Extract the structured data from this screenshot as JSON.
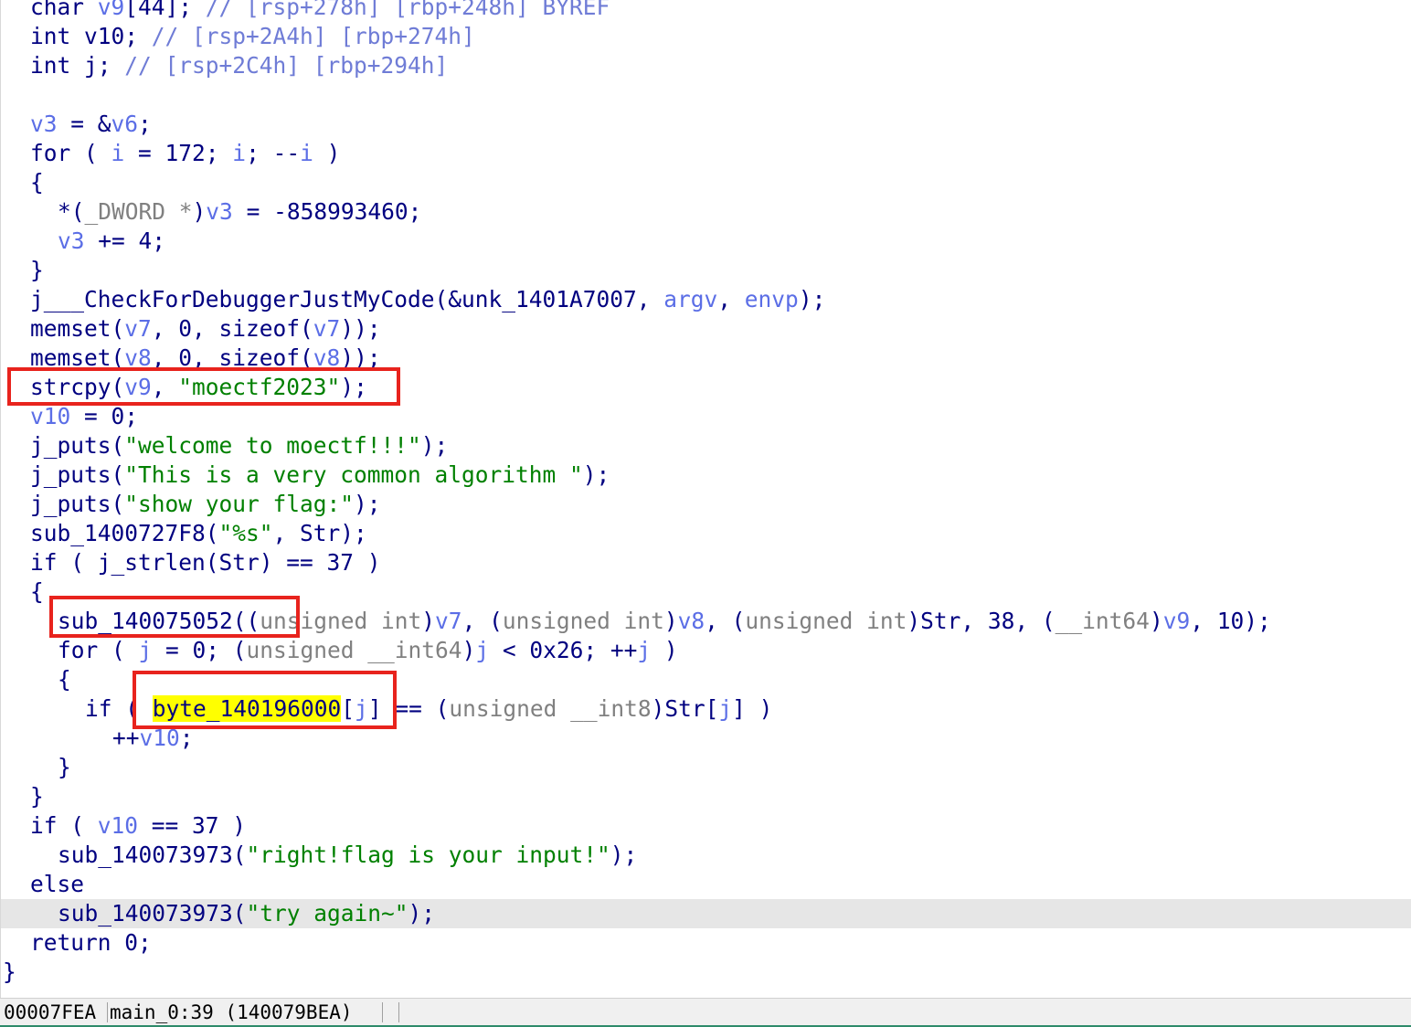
{
  "editor": {
    "lines": [
      {
        "indent": 2,
        "tokens": [
          {
            "t": "char ",
            "c": "k"
          },
          {
            "t": "v9",
            "c": "v"
          },
          {
            "t": "[44]; ",
            "c": "k"
          },
          {
            "t": "// [rsp+278h] [rbp+248h] BYREF",
            "c": "c"
          }
        ]
      },
      {
        "indent": 2,
        "tokens": [
          {
            "t": "int ",
            "c": "k"
          },
          {
            "t": "v10",
            "c": "k"
          },
          {
            "t": "; ",
            "c": "k"
          },
          {
            "t": "// [rsp+2A4h] [rbp+274h]",
            "c": "c"
          }
        ]
      },
      {
        "indent": 2,
        "tokens": [
          {
            "t": "int ",
            "c": "k"
          },
          {
            "t": "j",
            "c": "k"
          },
          {
            "t": "; ",
            "c": "k"
          },
          {
            "t": "// [rsp+2C4h] [rbp+294h]",
            "c": "c"
          }
        ]
      },
      {
        "indent": 0,
        "tokens": []
      },
      {
        "indent": 2,
        "tokens": [
          {
            "t": "v3",
            "c": "v"
          },
          {
            "t": " = &",
            "c": "k"
          },
          {
            "t": "v6",
            "c": "v"
          },
          {
            "t": ";",
            "c": "k"
          }
        ]
      },
      {
        "indent": 2,
        "tokens": [
          {
            "t": "for ( ",
            "c": "k"
          },
          {
            "t": "i",
            "c": "v"
          },
          {
            "t": " = 172; ",
            "c": "k"
          },
          {
            "t": "i",
            "c": "v"
          },
          {
            "t": "; --",
            "c": "k"
          },
          {
            "t": "i",
            "c": "v"
          },
          {
            "t": " )",
            "c": "k"
          }
        ]
      },
      {
        "indent": 2,
        "tokens": [
          {
            "t": "{",
            "c": "k"
          }
        ]
      },
      {
        "indent": 4,
        "tokens": [
          {
            "t": "*(",
            "c": "k"
          },
          {
            "t": "_DWORD *",
            "c": "t"
          },
          {
            "t": ")",
            "c": "k"
          },
          {
            "t": "v3",
            "c": "v"
          },
          {
            "t": " = -858993460;",
            "c": "k"
          }
        ]
      },
      {
        "indent": 4,
        "tokens": [
          {
            "t": "v3",
            "c": "v"
          },
          {
            "t": " += 4;",
            "c": "k"
          }
        ]
      },
      {
        "indent": 2,
        "tokens": [
          {
            "t": "}",
            "c": "k"
          }
        ]
      },
      {
        "indent": 2,
        "tokens": [
          {
            "t": "j___CheckForDebuggerJustMyCode(&unk_1401A7007, ",
            "c": "k"
          },
          {
            "t": "argv",
            "c": "v"
          },
          {
            "t": ", ",
            "c": "k"
          },
          {
            "t": "envp",
            "c": "v"
          },
          {
            "t": ");",
            "c": "k"
          }
        ]
      },
      {
        "indent": 2,
        "tokens": [
          {
            "t": "memset(",
            "c": "k"
          },
          {
            "t": "v7",
            "c": "v"
          },
          {
            "t": ", 0, sizeof(",
            "c": "k"
          },
          {
            "t": "v7",
            "c": "v"
          },
          {
            "t": "));",
            "c": "k"
          }
        ]
      },
      {
        "indent": 2,
        "tokens": [
          {
            "t": "memset(",
            "c": "k"
          },
          {
            "t": "v8",
            "c": "v"
          },
          {
            "t": ", 0, sizeof(",
            "c": "k"
          },
          {
            "t": "v8",
            "c": "v"
          },
          {
            "t": "));",
            "c": "k"
          }
        ]
      },
      {
        "indent": 2,
        "tokens": [
          {
            "t": "strcpy(",
            "c": "k"
          },
          {
            "t": "v9",
            "c": "v"
          },
          {
            "t": ", ",
            "c": "k"
          },
          {
            "t": "\"moectf2023\"",
            "c": "s"
          },
          {
            "t": ");",
            "c": "k"
          }
        ]
      },
      {
        "indent": 2,
        "tokens": [
          {
            "t": "v10",
            "c": "v"
          },
          {
            "t": " = 0;",
            "c": "k"
          }
        ]
      },
      {
        "indent": 2,
        "tokens": [
          {
            "t": "j_puts(",
            "c": "k"
          },
          {
            "t": "\"welcome to moectf!!!\"",
            "c": "s"
          },
          {
            "t": ");",
            "c": "k"
          }
        ]
      },
      {
        "indent": 2,
        "tokens": [
          {
            "t": "j_puts(",
            "c": "k"
          },
          {
            "t": "\"This is a very common algorithm \"",
            "c": "s"
          },
          {
            "t": ");",
            "c": "k"
          }
        ]
      },
      {
        "indent": 2,
        "tokens": [
          {
            "t": "j_puts(",
            "c": "k"
          },
          {
            "t": "\"show your flag:\"",
            "c": "s"
          },
          {
            "t": ");",
            "c": "k"
          }
        ]
      },
      {
        "indent": 2,
        "tokens": [
          {
            "t": "sub_1400727F8(",
            "c": "k"
          },
          {
            "t": "\"%s\"",
            "c": "s"
          },
          {
            "t": ", Str);",
            "c": "k"
          }
        ]
      },
      {
        "indent": 2,
        "tokens": [
          {
            "t": "if ( j_strlen(Str) == 37 )",
            "c": "k"
          }
        ]
      },
      {
        "indent": 2,
        "tokens": [
          {
            "t": "{",
            "c": "k"
          }
        ]
      },
      {
        "indent": 4,
        "tokens": [
          {
            "t": "sub_140075052((",
            "c": "k"
          },
          {
            "t": "unsigned int",
            "c": "t"
          },
          {
            "t": ")",
            "c": "k"
          },
          {
            "t": "v7",
            "c": "v"
          },
          {
            "t": ", (",
            "c": "k"
          },
          {
            "t": "unsigned int",
            "c": "t"
          },
          {
            "t": ")",
            "c": "k"
          },
          {
            "t": "v8",
            "c": "v"
          },
          {
            "t": ", (",
            "c": "k"
          },
          {
            "t": "unsigned int",
            "c": "t"
          },
          {
            "t": ")Str, 38, (",
            "c": "k"
          },
          {
            "t": "__int64",
            "c": "t"
          },
          {
            "t": ")",
            "c": "k"
          },
          {
            "t": "v9",
            "c": "v"
          },
          {
            "t": ", 10);",
            "c": "k"
          }
        ]
      },
      {
        "indent": 4,
        "tokens": [
          {
            "t": "for ( ",
            "c": "k"
          },
          {
            "t": "j",
            "c": "v"
          },
          {
            "t": " = 0; (",
            "c": "k"
          },
          {
            "t": "unsigned __int64",
            "c": "t"
          },
          {
            "t": ")",
            "c": "k"
          },
          {
            "t": "j",
            "c": "v"
          },
          {
            "t": " < 0x26; ++",
            "c": "k"
          },
          {
            "t": "j",
            "c": "v"
          },
          {
            "t": " )",
            "c": "k"
          }
        ]
      },
      {
        "indent": 4,
        "tokens": [
          {
            "t": "{",
            "c": "k"
          }
        ]
      },
      {
        "indent": 6,
        "tokens": [
          {
            "t": "if ( ",
            "c": "k"
          },
          {
            "t": "byte_140196000",
            "c": "k",
            "hl": true
          },
          {
            "t": "[",
            "c": "k"
          },
          {
            "t": "j",
            "c": "v"
          },
          {
            "t": "] == (",
            "c": "k"
          },
          {
            "t": "unsigned __int8",
            "c": "t"
          },
          {
            "t": ")Str[",
            "c": "k"
          },
          {
            "t": "j",
            "c": "v"
          },
          {
            "t": "] )",
            "c": "k"
          }
        ]
      },
      {
        "indent": 8,
        "tokens": [
          {
            "t": "++",
            "c": "k"
          },
          {
            "t": "v10",
            "c": "v"
          },
          {
            "t": ";",
            "c": "k"
          }
        ]
      },
      {
        "indent": 4,
        "tokens": [
          {
            "t": "}",
            "c": "k"
          }
        ]
      },
      {
        "indent": 2,
        "tokens": [
          {
            "t": "}",
            "c": "k"
          }
        ]
      },
      {
        "indent": 2,
        "tokens": [
          {
            "t": "if ( ",
            "c": "k"
          },
          {
            "t": "v10",
            "c": "v"
          },
          {
            "t": " == 37 )",
            "c": "k"
          }
        ]
      },
      {
        "indent": 4,
        "tokens": [
          {
            "t": "sub_140073973(",
            "c": "k"
          },
          {
            "t": "\"right!flag is your input!\"",
            "c": "s"
          },
          {
            "t": ");",
            "c": "k"
          }
        ]
      },
      {
        "indent": 2,
        "tokens": [
          {
            "t": "else",
            "c": "k"
          }
        ]
      },
      {
        "indent": 4,
        "current": true,
        "tokens": [
          {
            "t": "sub_140073973(",
            "c": "k"
          },
          {
            "t": "\"try again~\"",
            "c": "s"
          },
          {
            "t": ");",
            "c": "k"
          }
        ]
      },
      {
        "indent": 2,
        "tokens": [
          {
            "t": "return 0;",
            "c": "k"
          }
        ]
      },
      {
        "indent": 0,
        "tokens": [
          {
            "t": "}",
            "c": "k"
          }
        ]
      }
    ]
  },
  "annotations": [
    {
      "name": "strcpy-highlight-box"
    },
    {
      "name": "sub-call-highlight-box"
    },
    {
      "name": "byte-array-highlight-box"
    }
  ],
  "status_bar": {
    "address": "00007FEA",
    "location": "main_0:39 (140079BEA)"
  },
  "colors": {
    "keyword": "#000080",
    "variable": "#5b6ee6",
    "string": "#008000",
    "comment": "#6f7cd6",
    "type": "#808080",
    "selection": "#ffff00",
    "current_line": "#e6e6e6",
    "annotation_box": "#e8231d"
  }
}
